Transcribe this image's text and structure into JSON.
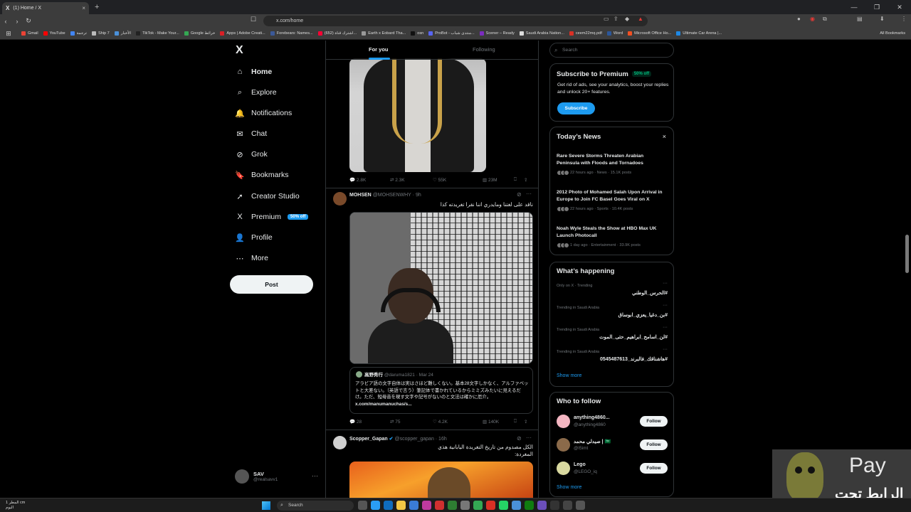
{
  "browser": {
    "tab_title": "(1) Home / X",
    "tab_close": "×",
    "new_tab": "+",
    "url": "x.com/home",
    "bookmarks": [
      {
        "label": "Gmail",
        "color": "#ea4335"
      },
      {
        "label": "YouTube",
        "color": "#ff0000"
      },
      {
        "label": "ترجمة",
        "color": "#4285f4"
      },
      {
        "label": "Ship 7",
        "color": "#bbbbbb"
      },
      {
        "label": "الأخبار",
        "color": "#4a90d9"
      },
      {
        "label": "TikTok - Make Your...",
        "color": "#222222"
      },
      {
        "label": "Google خرائط",
        "color": "#34a853"
      },
      {
        "label": "Apps | Adobe Creati...",
        "color": "#da1f26"
      },
      {
        "label": "Forebears: Names...",
        "color": "#3b5998"
      },
      {
        "label": "(652) اشترك قناة...",
        "color": "#ff0033"
      },
      {
        "label": "Earth x Eobard Tha...",
        "color": "#999999"
      },
      {
        "label": "osn",
        "color": "#111111"
      },
      {
        "label": "ProBot - منتدى شباب...",
        "color": "#5865f2"
      },
      {
        "label": "Scener – Ready",
        "color": "#7b2cbf"
      },
      {
        "label": "Saudi Arabia Nation...",
        "color": "#dddddd"
      },
      {
        "label": "ceem22mq.pdf",
        "color": "#d93025"
      },
      {
        "label": "Word",
        "color": "#2b579a"
      },
      {
        "label": "Microsoft Office Ho...",
        "color": "#f25022"
      },
      {
        "label": "Ultimate Car Arena |...",
        "color": "#1e88e5"
      }
    ],
    "all_bookmarks": "All Bookmarks"
  },
  "nav": {
    "logo": "X",
    "items": [
      {
        "label": "Home",
        "icon": "home-icon",
        "glyph": "⌂"
      },
      {
        "label": "Explore",
        "icon": "search-icon",
        "glyph": "⌕"
      },
      {
        "label": "Notifications",
        "icon": "bell-icon",
        "glyph": "🔔"
      },
      {
        "label": "Chat",
        "icon": "mail-icon",
        "glyph": "✉"
      },
      {
        "label": "Grok",
        "icon": "grok-icon",
        "glyph": "⊘"
      },
      {
        "label": "Bookmarks",
        "icon": "bookmark-icon",
        "glyph": "🔖"
      },
      {
        "label": "Creator Studio",
        "icon": "rocket-icon",
        "glyph": "➚"
      },
      {
        "label": "Premium",
        "icon": "x-premium-icon",
        "glyph": "X"
      },
      {
        "label": "Profile",
        "icon": "person-icon",
        "glyph": "👤"
      },
      {
        "label": "More",
        "icon": "more-icon",
        "glyph": "⋯"
      }
    ],
    "premium_badge": "50% off",
    "post_label": "Post",
    "account": {
      "name": "SAV",
      "handle": "@realsavv1",
      "dots": "···"
    }
  },
  "timeline": {
    "tabs": {
      "for_you": "For you",
      "following": "Following"
    },
    "tweet1_actions": {
      "replies": "2.8K",
      "reposts": "2.3K",
      "likes": "55K",
      "views": "23M"
    },
    "tweet2": {
      "name": "MOHSEN",
      "meta": "@MOHSENWHY · 9h",
      "text": "ناقد على لغتنا ومايدري اننا نقرا تغريدته كذا",
      "quote": {
        "name": "高野秀行",
        "meta": "@daruma1821 · Mar 24",
        "text": "アラビア語の文字自体は実はさほど難しくない。基本28文字しかなく、アルファベットと大差ない。（英語で言う）筆記体で書かれているからミミズみたいに見えるだけ。ただ、短母音を現す文字や記号がないのと文法は確かに厄介。",
        "link": "x.com/manumanuchas/s..."
      },
      "actions": {
        "replies": "28",
        "reposts": "75",
        "likes": "4.2K",
        "views": "140K"
      }
    },
    "tweet3": {
      "name": "Scopper_Gapan",
      "meta": "@scopper_gapan · 16h",
      "text": "الكل مصدوم من تاريخ التغريدة اليابانية هذي المغردة:"
    }
  },
  "right": {
    "search_placeholder": "Search",
    "premium": {
      "title": "Subscribe to Premium",
      "badge": "50% off",
      "desc": "Get rid of ads, see your analytics, boost your replies and unlock 20+ features.",
      "button": "Subscribe"
    },
    "news": {
      "title": "Today’s News",
      "close": "×",
      "items": [
        {
          "title": "Rare Severe Storms Threaten Arabian Peninsula with Floods and Tornadoes",
          "meta": "22 hours ago · News · 15.1K posts"
        },
        {
          "title": "2012 Photo of Mohamed Salah Upon Arrival in Europe to Join FC Basel Goes Viral on X",
          "meta": "22 hours ago · Sports · 10.4K posts"
        },
        {
          "title": "Noah Wyle Steals the Show at HBO Max UK Launch Photocall",
          "meta": "1 day ago · Entertainment · 33.9K posts"
        }
      ]
    },
    "happening": {
      "title": "What’s happening",
      "items": [
        {
          "context": "Only on X · Trending",
          "tag": "#الحرس_الوطني"
        },
        {
          "context": "Trending in Saudi Arabia",
          "tag": "#بن_دغيا_يعزي_ابوساق"
        },
        {
          "context": "Trending in Saudi Arabia",
          "tag": "#لن_اسامح_ابراهيم_حتى_الموت"
        },
        {
          "context": "Trending in Saudi Arabia",
          "tag": "#هاشناقك_فالبرند_0545487613"
        }
      ],
      "dots": "···",
      "show_more": "Show more"
    },
    "who_to_follow": {
      "title": "Who to follow",
      "users": [
        {
          "name": "anything4860...",
          "handle": "@anything4860",
          "color": "#f4b6c2"
        },
        {
          "name": "صيدلي محمد | 🇸🇦",
          "handle": "@I5imt",
          "color": "#8b6a4a"
        },
        {
          "name": "Lego",
          "handle": "@LEGO_iq",
          "color": "#d9d9a0"
        }
      ],
      "follow_label": "Follow",
      "show_more": "Show more"
    }
  },
  "overlay": {
    "brand": " Pay",
    "arabic": "الرابط تحت"
  },
  "taskbar": {
    "weather_line1": "المطر 1 cm",
    "weather_line2": "اليوم",
    "search": "Search"
  }
}
